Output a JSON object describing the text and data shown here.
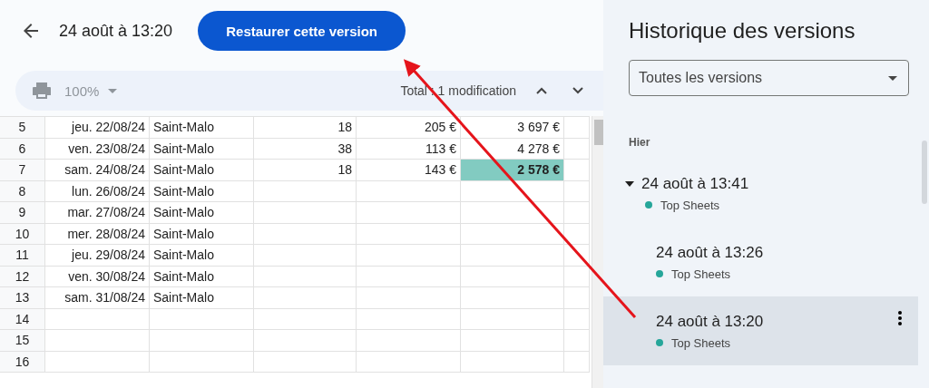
{
  "header": {
    "title": "24 août à 13:20",
    "restore_button": "Restaurer cette version"
  },
  "toolbar": {
    "zoom": "100%",
    "disabled": true,
    "changes": "Total : 1 modification"
  },
  "sheet": {
    "rows": [
      {
        "number": "5",
        "cells": [
          "jeu. 22/08/24",
          "Saint-Malo",
          "18",
          "205 €",
          "3 697 €"
        ],
        "total_highlighted": false
      },
      {
        "number": "6",
        "cells": [
          "ven. 23/08/24",
          "Saint-Malo",
          "38",
          "113 €",
          "4 278 €"
        ],
        "total_highlighted": false
      },
      {
        "number": "7",
        "cells": [
          "sam. 24/08/24",
          "Saint-Malo",
          "18",
          "143 €",
          "2 578 €"
        ],
        "total_highlighted": true
      },
      {
        "number": "8",
        "cells": [
          "lun. 26/08/24",
          "Saint-Malo"
        ],
        "total_highlighted": false
      },
      {
        "number": "9",
        "cells": [
          "mar. 27/08/24",
          "Saint-Malo"
        ],
        "total_highlighted": false
      },
      {
        "number": "10",
        "cells": [
          "mer. 28/08/24",
          "Saint-Malo"
        ],
        "total_highlighted": false
      },
      {
        "number": "11",
        "cells": [
          "jeu. 29/08/24",
          "Saint-Malo"
        ],
        "total_highlighted": false
      },
      {
        "number": "12",
        "cells": [
          "ven. 30/08/24",
          "Saint-Malo"
        ],
        "total_highlighted": false
      },
      {
        "number": "13",
        "cells": [
          "sam. 31/08/24",
          "Saint-Malo"
        ],
        "total_highlighted": false
      },
      {
        "number": "14",
        "cells": [],
        "total_highlighted": false
      },
      {
        "number": "15",
        "cells": [],
        "total_highlighted": false
      },
      {
        "number": "16",
        "cells": [],
        "total_highlighted": false
      }
    ]
  },
  "sidebar": {
    "title": "Historique des versions",
    "filter": {
      "value": "Toutes les versions"
    },
    "section": "Hier",
    "versions": [
      {
        "time": "24 août à 13:41",
        "author": "Top Sheets",
        "color": "#26a69a",
        "selected": false,
        "expanded": true,
        "children": [
          {
            "time": "24 août à 13:26",
            "author": "Top Sheets",
            "color": "#26a69a",
            "selected": false
          },
          {
            "time": "24 août à 13:20",
            "author": "Top Sheets",
            "color": "#26a69a",
            "selected": true
          }
        ]
      }
    ]
  }
}
